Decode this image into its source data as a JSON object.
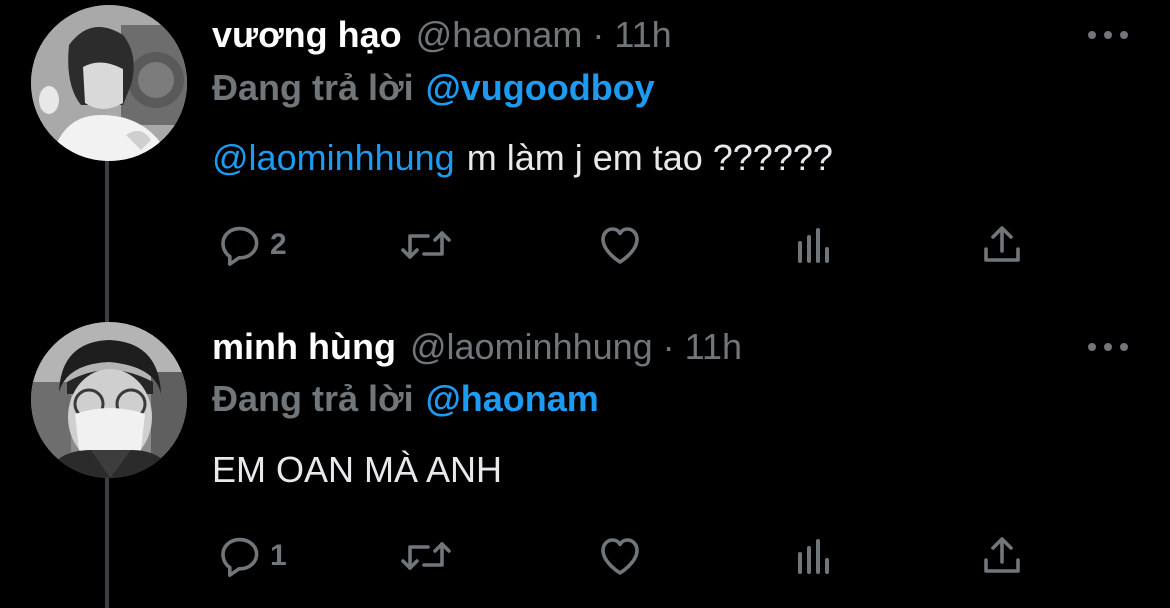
{
  "tweets": [
    {
      "display_name": "vương hạo",
      "handle": "@haonam",
      "separator": "·",
      "time": "11h",
      "reply_prefix": "Đang trả lời",
      "reply_to": "@vugoodboy",
      "mention": "@laominhhung",
      "text": "m làm j em tao ??????",
      "reply_count": "2"
    },
    {
      "display_name": "minh hùng",
      "handle": "@laominhhung",
      "separator": "·",
      "time": "11h",
      "reply_prefix": "Đang trả lời",
      "reply_to": "@haonam",
      "mention": "",
      "text": "EM OAN MÀ ANH",
      "reply_count": "1"
    }
  ],
  "icons": {
    "reply": "reply-icon",
    "retweet": "retweet-icon",
    "like": "heart-icon",
    "stats": "stats-icon",
    "share": "share-icon",
    "more": "more-icon"
  },
  "colors": {
    "background": "#000000",
    "text": "#e7e9ea",
    "muted": "#71767b",
    "link": "#1d9bf0",
    "thread_line": "#3b3e41"
  }
}
